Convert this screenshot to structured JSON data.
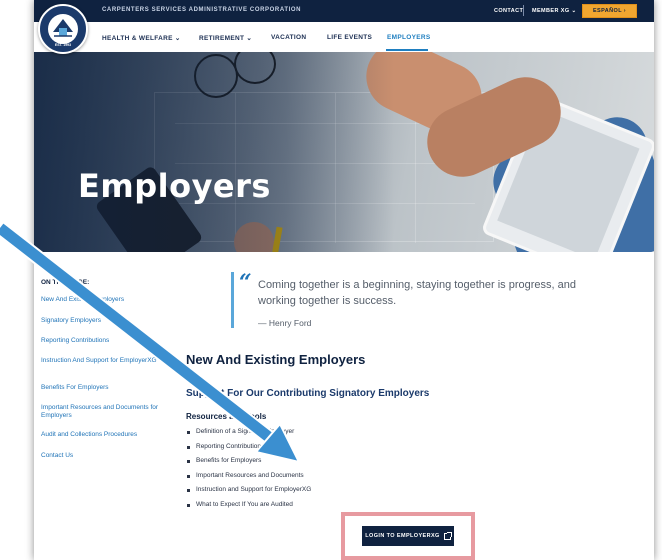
{
  "topbar": {
    "org_name": "CARPENTERS SERVICES ADMINISTRATIVE CORPORATION",
    "contact": "CONTACT",
    "member": "MEMBER XG ⌄",
    "espanol": "ESPAÑOL ›"
  },
  "logo": {
    "est": "EST. 1993"
  },
  "nav": {
    "items": [
      {
        "label": "HEALTH & WELFARE ⌄"
      },
      {
        "label": "RETIREMENT ⌄"
      },
      {
        "label": "VACATION"
      },
      {
        "label": "LIFE EVENTS"
      },
      {
        "label": "EMPLOYERS"
      }
    ]
  },
  "hero": {
    "title": "Employers"
  },
  "sidebar": {
    "heading": "ON THIS PAGE:",
    "links": [
      "New And Existing Employers",
      "Signatory Employers",
      "Reporting Contributions",
      "Instruction And Support for EmployerXG",
      "Benefits For Employers",
      "Important Resources and Documents for Employers",
      "Audit and Collections Procedures",
      "Contact Us"
    ]
  },
  "quote": {
    "mark": "“",
    "text": "Coming together is a beginning, staying together is progress, and working together is success.",
    "author": "— Henry Ford"
  },
  "main": {
    "heading": "New And Existing Employers",
    "subheading": "Support For Our Contributing Signatory Employers",
    "resources_heading": "Resources and Tools",
    "bullets": [
      "Definition of a Signatory Employer",
      "Reporting Contributions",
      "Benefits for Employers",
      "Important Resources and Documents",
      "Instruction and Support for EmployerXG",
      "What to Expect If You are Audited"
    ],
    "login_button": "LOGIN TO EMPLOYERXG"
  },
  "colors": {
    "navy": "#0f2240",
    "link_blue": "#1f73b7",
    "accent_orange": "#f0a630",
    "arrow_blue": "#3b8fd0",
    "highlight_pink": "#e79aa0"
  }
}
